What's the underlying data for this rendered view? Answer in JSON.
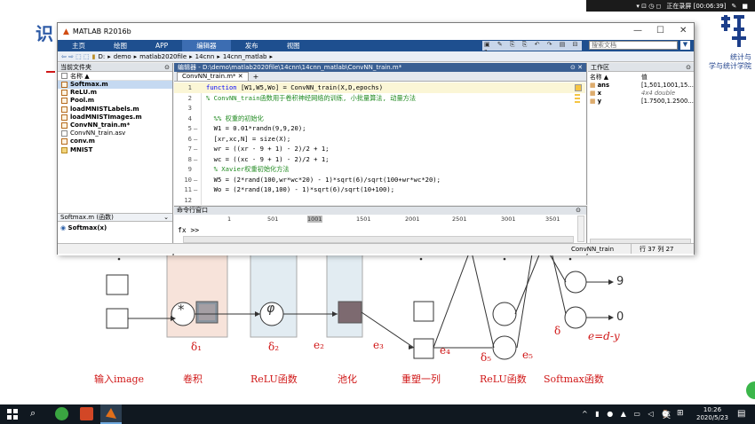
{
  "recording": {
    "status": "正在录屏 [00:06:39]"
  },
  "slide": {
    "title_fragment": "识",
    "school_line1": "统计与",
    "school_line2": "学与统计学院",
    "labels": {
      "conv_in": "δ₁",
      "d2": "δ₂",
      "e2": "e₂",
      "e3": "e₃",
      "e4": "e₄",
      "d5": "δ₅",
      "e5": "e₅",
      "delta": "δ",
      "err": "e=d-y",
      "out9": "9",
      "out0": "0"
    },
    "stages": [
      "输入image",
      "卷积",
      "ReLU函数",
      "池化",
      "重塑一列",
      "ReLU函数",
      "Softmax函数"
    ],
    "symbols": {
      "conv": "*",
      "phi": "φ"
    }
  },
  "matlab": {
    "title": "MATLAB R2016b",
    "ribbon_tabs": [
      "主页",
      "绘图",
      "APP",
      "编辑器",
      "发布",
      "视图"
    ],
    "search_placeholder": "搜索文档",
    "path": [
      "D:",
      "demo",
      "matlab2020file",
      "14cnn",
      "14cnn_matlab"
    ],
    "left_header": "当前文件夹",
    "name_col": "名称 ▲",
    "files": [
      "Softmax.m",
      "ReLU.m",
      "Pool.m",
      "loadMNISTLabels.m",
      "loadMNISTImages.m",
      "ConvNN_train.m*",
      "ConvNN_train.asv",
      "conv.m",
      "MNIST"
    ],
    "detail_header": "Softmax.m (函数)",
    "detail_value": "Softmax(x)",
    "editor_header": "编辑器 - D:\\demo\\matlab2020file\\14cnn\\14cnn_matlab\\ConvNN_train.m*",
    "editor_tab": "ConvNN_train.m*",
    "code": [
      {
        "n": "1",
        "d": "",
        "parts": [
          [
            "kw",
            "function "
          ],
          [
            "",
            "[W1,W5,Wo] = ConvNN_train(X,D,epochs)"
          ]
        ]
      },
      {
        "n": "2",
        "d": "",
        "parts": [
          [
            "cm",
            "% ConvNN_train函数用于卷积神经网络的训练, 小批量算法, 动量方法"
          ]
        ]
      },
      {
        "n": "3",
        "d": "",
        "parts": [
          [
            "",
            ""
          ]
        ]
      },
      {
        "n": "4",
        "d": "",
        "parts": [
          [
            "cm",
            "  %% 权重的初始化"
          ]
        ]
      },
      {
        "n": "5",
        "d": "—",
        "parts": [
          [
            "",
            "  W1 = 0.01*randn(9,9,20);"
          ]
        ]
      },
      {
        "n": "6",
        "d": "—",
        "parts": [
          [
            "",
            "  [xr,xc,N] = size(X);"
          ]
        ]
      },
      {
        "n": "7",
        "d": "—",
        "parts": [
          [
            "",
            "  wr = ((xr - 9 + 1) - 2)/2 + 1;"
          ]
        ]
      },
      {
        "n": "8",
        "d": "—",
        "parts": [
          [
            "",
            "  wc = ((xc - 9 + 1) - 2)/2 + 1;"
          ]
        ]
      },
      {
        "n": "9",
        "d": "",
        "parts": [
          [
            "cm",
            "  % Xavier权重初始化方法"
          ]
        ]
      },
      {
        "n": "10",
        "d": "—",
        "parts": [
          [
            "",
            "  W5 = (2*rand(100,wr*wc*20) - 1)*sqrt(6)/sqrt(100+wr*wc*20);"
          ]
        ]
      },
      {
        "n": "11",
        "d": "—",
        "parts": [
          [
            "",
            "  Wo = (2*rand(10,100) - 1)*sqrt(6)/sqrt(10+100);"
          ]
        ]
      },
      {
        "n": "12",
        "d": "",
        "parts": [
          [
            "",
            ""
          ]
        ]
      }
    ],
    "cmd_header": "命令行窗口",
    "cmd_overlap": [
      "1",
      "501",
      "1001",
      "1501",
      "2001",
      "2501",
      "3001",
      "3501"
    ],
    "prompt": "fx >>",
    "ws_header": "工作区",
    "ws_cols": [
      "名称 ▲",
      "值"
    ],
    "ws_rows": [
      {
        "name": "ans",
        "value": "[1,501,1001,15..."
      },
      {
        "name": "x",
        "value": "4x4 double"
      },
      {
        "name": "y",
        "value": "[1.7500,1.2500..."
      }
    ],
    "status_file": "ConvNN_train",
    "status_pos": "行 37   列 27"
  },
  "taskbar": {
    "ime": "英",
    "time": "10:26",
    "date": "2020/5/23"
  }
}
